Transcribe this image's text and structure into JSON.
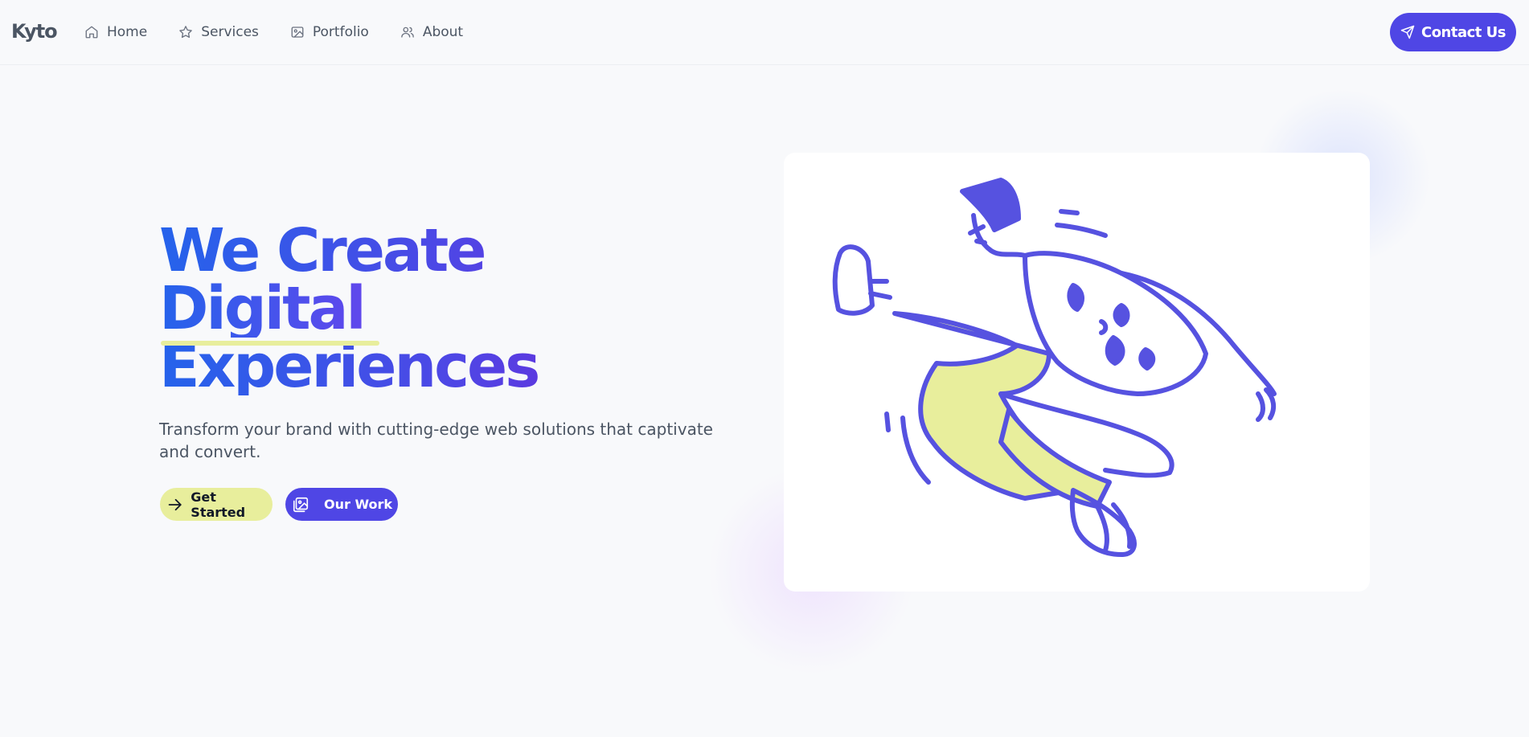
{
  "brand": {
    "logo": "Kyto"
  },
  "nav": {
    "items": [
      {
        "label": "Home",
        "icon": "home-icon"
      },
      {
        "label": "Services",
        "icon": "star-icon"
      },
      {
        "label": "Portfolio",
        "icon": "image-icon"
      },
      {
        "label": "About",
        "icon": "users-icon"
      }
    ],
    "cta": {
      "label": "Contact Us",
      "icon": "send-icon"
    }
  },
  "hero": {
    "title_line1": "We Create",
    "title_line2": "Digital",
    "title_line3": "Experiences",
    "subtitle": "Transform your brand with cutting-edge web solutions that captivate and convert.",
    "primary_button": {
      "label": "Get Started",
      "icon": "arrow-right-icon"
    },
    "secondary_button": {
      "label": "Our Work",
      "icon": "gallery-icon"
    }
  },
  "illustration": {
    "subject": "jumping-person-illustration"
  },
  "colors": {
    "accent": "#4f46e5",
    "highlight": "#e8ee9c",
    "gradient_start": "#2563eb",
    "gradient_end": "#a21caf"
  }
}
